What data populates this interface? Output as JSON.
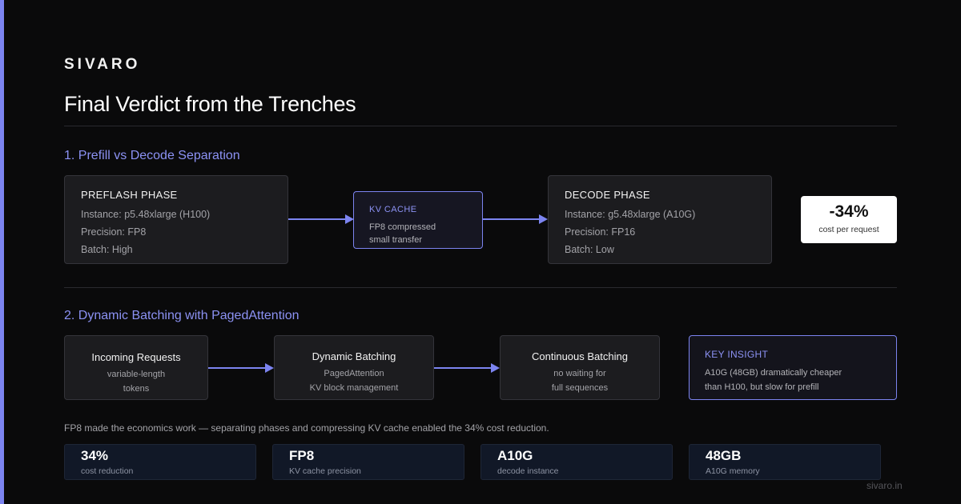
{
  "brand": "SIVARO",
  "title": "Final Verdict from the Trenches",
  "section1": {
    "heading": "1. Prefill vs Decode Separation",
    "prefill": {
      "title": "PREFLASH PHASE",
      "lines": [
        "Instance: p5.48xlarge (H100)",
        "Precision: FP8",
        "Batch: High"
      ]
    },
    "kv_cache": {
      "title": "KV CACHE",
      "lines": [
        "FP8 compressed",
        "small transfer"
      ]
    },
    "decode": {
      "title": "DECODE PHASE",
      "lines": [
        "Instance: g5.48xlarge (A10G)",
        "Precision: FP16",
        "Batch: Low"
      ]
    },
    "cost": {
      "value": "-34%",
      "label": "cost per request"
    }
  },
  "section2": {
    "heading": "2. Dynamic Batching with PagedAttention",
    "steps": [
      {
        "title": "Incoming Requests",
        "lines": [
          "variable-length",
          "tokens"
        ]
      },
      {
        "title": "Dynamic Batching",
        "lines": [
          "PagedAttention",
          "KV block management"
        ]
      },
      {
        "title": "Continuous Batching",
        "lines": [
          "no waiting for",
          "full sequences"
        ]
      }
    ],
    "insight": {
      "title": "KEY INSIGHT",
      "lines": [
        "A10G (48GB) dramatically cheaper",
        "than H100, but slow for prefill"
      ]
    }
  },
  "summary": "FP8 made the economics work — separating phases and compressing KV cache enabled the 34% cost reduction.",
  "stats": [
    {
      "value": "34%",
      "label": "cost reduction"
    },
    {
      "value": "FP8",
      "label": "KV cache precision"
    },
    {
      "value": "A10G",
      "label": "decode instance"
    },
    {
      "value": "48GB",
      "label": "A10G memory"
    }
  ],
  "footer": "sivaro.in",
  "colors": {
    "accent": "#7c84f0",
    "background": "#0a0a0b",
    "box": "#1c1c1f"
  }
}
